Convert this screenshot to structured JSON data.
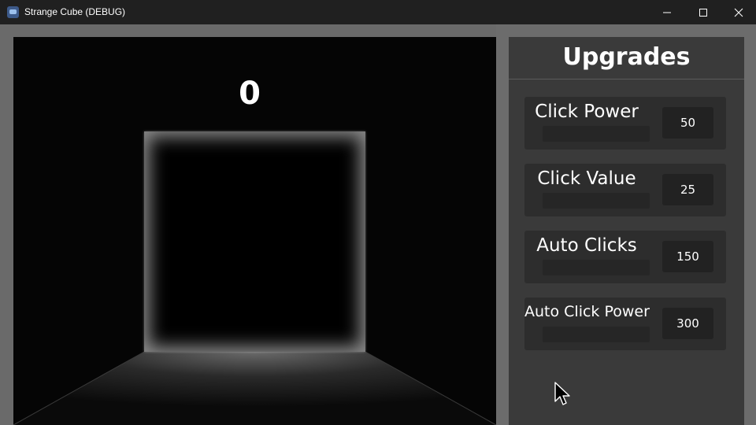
{
  "window": {
    "title": "Strange Cube (DEBUG)",
    "icon": "godot-engine-icon",
    "controls": [
      "minimize-icon",
      "maximize-icon",
      "close-icon"
    ]
  },
  "game": {
    "score": "0"
  },
  "upgrades": {
    "title": "Upgrades",
    "items": [
      {
        "label": "Click Power",
        "cost": "50"
      },
      {
        "label": "Click Value",
        "cost": "25"
      },
      {
        "label": "Auto Clicks",
        "cost": "150"
      },
      {
        "label": "Auto Click Power",
        "cost": "300"
      }
    ]
  },
  "colors": {
    "window_chrome": "#202020",
    "stage_background": "#050505",
    "panel_background": "#3a3a3a",
    "upgrade_background": "#2d2d2d",
    "text": "#ffffff"
  }
}
